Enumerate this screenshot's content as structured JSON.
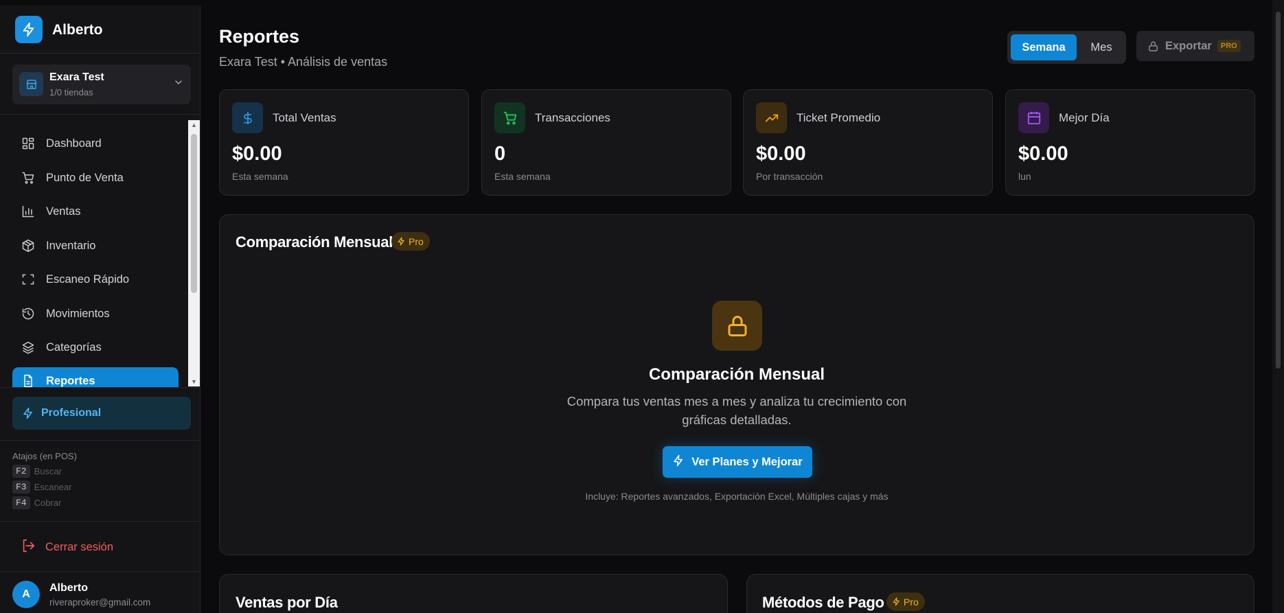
{
  "sidebar": {
    "brand_name": "Alberto",
    "store": {
      "name": "Exara Test",
      "sub": "1/0 tiendas"
    },
    "nav": [
      {
        "label": "Dashboard",
        "icon": "dashboard-icon"
      },
      {
        "label": "Punto de Venta",
        "icon": "cart-icon"
      },
      {
        "label": "Ventas",
        "icon": "bar-chart-icon"
      },
      {
        "label": "Inventario",
        "icon": "box-icon"
      },
      {
        "label": "Escaneo Rápido",
        "icon": "scan-icon"
      },
      {
        "label": "Movimientos",
        "icon": "history-icon"
      },
      {
        "label": "Categorías",
        "icon": "layers-icon"
      },
      {
        "label": "Reportes",
        "icon": "report-icon",
        "active": true
      }
    ],
    "plan_label": "Profesional",
    "shortcuts": {
      "title": "Atajos (en POS)",
      "items": [
        {
          "key": "F2",
          "label": "Buscar"
        },
        {
          "key": "F3",
          "label": "Escanear"
        },
        {
          "key": "F4",
          "label": "Cobrar"
        }
      ]
    },
    "logout_label": "Cerrar sesión",
    "user": {
      "initial": "A",
      "name": "Alberto",
      "email": "riveraproker@gmail.com"
    }
  },
  "header": {
    "title": "Reportes",
    "subtitle": "Exara Test • Análisis de ventas",
    "period": {
      "week": "Semana",
      "month": "Mes",
      "selected": "Semana"
    },
    "export_label": "Exportar",
    "export_tag": "PRO"
  },
  "stats": [
    {
      "label": "Total Ventas",
      "value": "$0.00",
      "sub": "Esta semana",
      "icon": "dollar-icon",
      "color": "#2f9ae0"
    },
    {
      "label": "Transacciones",
      "value": "0",
      "sub": "Esta semana",
      "icon": "cart-icon",
      "color": "#22c55e"
    },
    {
      "label": "Ticket Promedio",
      "value": "$0.00",
      "sub": "Por transacción",
      "icon": "trending-up-icon",
      "color": "#f59e0b"
    },
    {
      "label": "Mejor Día",
      "value": "$0.00",
      "sub": "lun",
      "icon": "calendar-icon",
      "color": "#a855f7"
    }
  ],
  "monthly": {
    "title": "Comparación Mensual",
    "badge": "Pro",
    "locked_title": "Comparación Mensual",
    "locked_desc": "Compara tus ventas mes a mes y analiza tu crecimiento con gráficas detalladas.",
    "button_label": "Ver Planes y Mejorar",
    "includes": "Incluye: Reportes avanzados, Exportación Excel, Múltiples cajas y más"
  },
  "bottom": {
    "daily_title": "Ventas por Día",
    "payments_title": "Métodos de Pago",
    "payments_badge": "Pro"
  },
  "colors": {
    "accent": "#0f86d4",
    "pro": "#f5b02e",
    "danger": "#f25c5c",
    "background": "#0b0b0d"
  }
}
